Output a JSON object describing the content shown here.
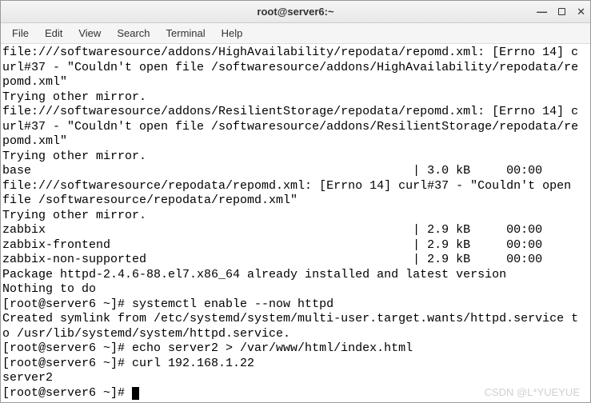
{
  "window": {
    "title": "root@server6:~"
  },
  "menu": {
    "items": [
      "File",
      "Edit",
      "View",
      "Search",
      "Terminal",
      "Help"
    ]
  },
  "terminal": {
    "lines": [
      "file:///softwaresource/addons/HighAvailability/repodata/repomd.xml: [Errno 14] c",
      "url#37 - \"Couldn't open file /softwaresource/addons/HighAvailability/repodata/re",
      "pomd.xml\"",
      "Trying other mirror.",
      "file:///softwaresource/addons/ResilientStorage/repodata/repomd.xml: [Errno 14] c",
      "url#37 - \"Couldn't open file /softwaresource/addons/ResilientStorage/repodata/re",
      "pomd.xml\"",
      "Trying other mirror.",
      "base                                                     | 3.0 kB     00:00",
      "file:///softwaresource/repodata/repomd.xml: [Errno 14] curl#37 - \"Couldn't open",
      "file /softwaresource/repodata/repomd.xml\"",
      "Trying other mirror.",
      "zabbix                                                   | 2.9 kB     00:00",
      "zabbix-frontend                                          | 2.9 kB     00:00",
      "zabbix-non-supported                                     | 2.9 kB     00:00",
      "Package httpd-2.4.6-88.el7.x86_64 already installed and latest version",
      "Nothing to do",
      "[root@server6 ~]# systemctl enable --now httpd",
      "Created symlink from /etc/systemd/system/multi-user.target.wants/httpd.service t",
      "o /usr/lib/systemd/system/httpd.service.",
      "[root@server6 ~]# echo server2 > /var/www/html/index.html",
      "[root@server6 ~]# curl 192.168.1.22",
      "server2",
      "[root@server6 ~]# "
    ]
  },
  "watermark": "CSDN @L*YUEYUE"
}
